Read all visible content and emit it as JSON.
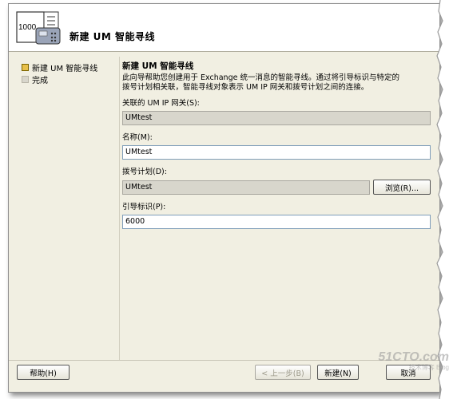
{
  "header": {
    "icon_name": "phone-directory-icon",
    "icon_number": "1000",
    "title": "新建 UM 智能寻线"
  },
  "nav": {
    "items": [
      {
        "label": "新建 UM 智能寻线",
        "state": "active"
      },
      {
        "label": "完成",
        "state": "inactive"
      }
    ]
  },
  "main": {
    "section_title": "新建 UM 智能寻线",
    "description_line1": "此向导帮助您创建用于 Exchange 统一消息的智能寻线。通过将引导标识与特定的",
    "description_line2": "拨号计划相关联，智能寻线对象表示 UM IP 网关和拨号计划之间的连接。",
    "fields": {
      "ip_gateway": {
        "label": "关联的 UM IP 网关(S):",
        "value": "UMtest"
      },
      "name": {
        "label": "名称(M):",
        "value": "UMtest"
      },
      "dial_plan": {
        "label": "拨号计划(D):",
        "value": "UMtest",
        "browse_label": "浏览(R)..."
      },
      "pilot_identifier": {
        "label": "引导标识(P):",
        "value": "6000"
      }
    }
  },
  "footer": {
    "help_label": "帮助(H)",
    "back_label": "< 上一步(B)",
    "next_label": "新建(N)",
    "cancel_label": "取消"
  },
  "watermark": {
    "main": "51CTO.com",
    "sub": "技术博客 Blog"
  },
  "colors": {
    "dialog_bg": "#f1efe2",
    "active_nav": "#e8c04a",
    "readonly_field": "#d8d6cc"
  }
}
